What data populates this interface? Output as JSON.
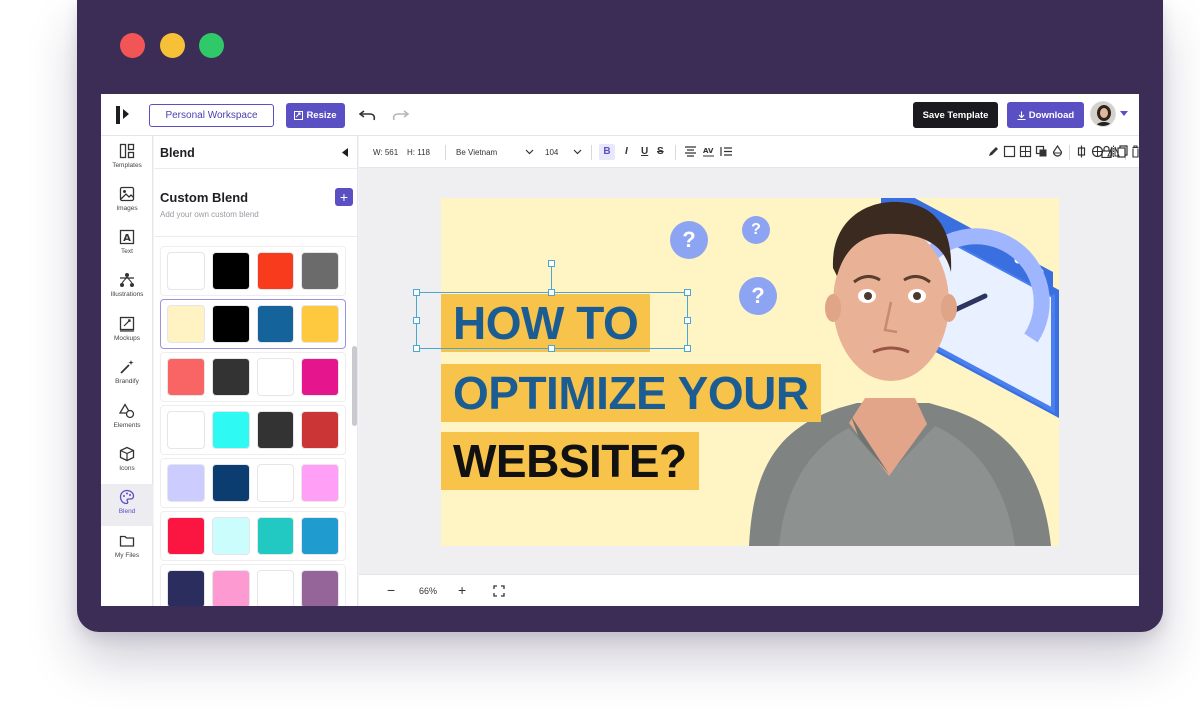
{
  "window": {
    "traffic_lights": {
      "red": "#f25555",
      "yellow": "#f7c137",
      "green": "#2fc96a"
    },
    "frame_color": "#3b2d55"
  },
  "topbar": {
    "logo_icon": "brand-logo-icon",
    "workspace_label": "Personal Workspace",
    "resize_label": "Resize",
    "save_template_label": "Save Template",
    "download_label": "Download",
    "accent": "#5b4fc4"
  },
  "rail": {
    "items": [
      {
        "label": "Templates",
        "icon": "templates-icon"
      },
      {
        "label": "Images",
        "icon": "images-icon"
      },
      {
        "label": "Text",
        "icon": "text-icon"
      },
      {
        "label": "Illustrations",
        "icon": "illustrations-icon"
      },
      {
        "label": "Mockups",
        "icon": "mockups-icon"
      },
      {
        "label": "Brandify",
        "icon": "magic-wand-icon"
      },
      {
        "label": "Elements",
        "icon": "shapes-icon"
      },
      {
        "label": "Icons",
        "icon": "cube-icon"
      },
      {
        "label": "Blend",
        "icon": "palette-icon",
        "active": true
      },
      {
        "label": "My Files",
        "icon": "folder-icon"
      }
    ]
  },
  "panel": {
    "title": "Blend",
    "custom_title": "Custom Blend",
    "custom_subtitle": "Add your own custom blend",
    "palettes": [
      [
        "#ffffff",
        "#000000",
        "#f73b1c",
        "#6b6b6b"
      ],
      [
        "#fff3c4",
        "#000000",
        "#14639a",
        "#ffc93f"
      ],
      [
        "#f96464",
        "#333333",
        "#ffffff",
        "#e5168d"
      ],
      [
        "#ffffff",
        "#2ef9f3",
        "#333333",
        "#cb3535"
      ],
      [
        "#ccccff",
        "#0c3d70",
        "#ffffff",
        "#ff9ff5"
      ],
      [
        "#fb1541",
        "#ccfdfd",
        "#22c8c2",
        "#1f9bd0"
      ],
      [
        "#2b2d5e",
        "#fd9ad1",
        "#ffffff",
        "#956499"
      ]
    ],
    "selected_palette": 1
  },
  "format_toolbar": {
    "width_label": "W: 561",
    "height_label": "H: 118",
    "font_family": "Be Vietnam",
    "font_size": "104",
    "bold": "B",
    "italic": "I",
    "underline": "U",
    "strikethrough": "S"
  },
  "canvas": {
    "line1": "HOW TO",
    "line2": "OPTIMIZE YOUR",
    "line3": "WEBSITE?",
    "question_mark": "?",
    "background": "#fff5c4",
    "highlight": "#f7c34a",
    "text_blue": "#1b5d93"
  },
  "bottombar": {
    "zoom": "66%",
    "minus": "−",
    "plus": "+"
  }
}
